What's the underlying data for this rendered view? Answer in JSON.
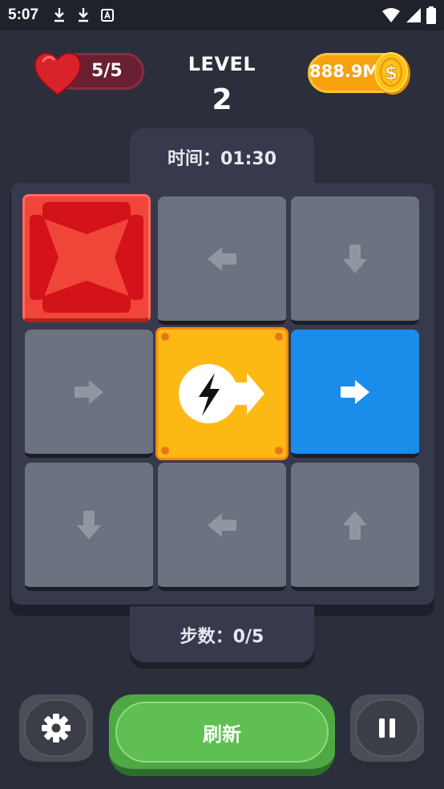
{
  "status_bar": {
    "time": "5:07",
    "left_icons": [
      "download-icon",
      "download-icon",
      "text-a-icon"
    ],
    "right_icons": [
      "wifi-icon",
      "signal-icon",
      "battery-icon"
    ]
  },
  "header": {
    "lives": "5/5",
    "level_label": "LEVEL",
    "level_number": "2",
    "coins": "888.9M",
    "coin_symbol": "$"
  },
  "timer": {
    "text": "时间：01:30"
  },
  "board": {
    "rows": 3,
    "cols": 3,
    "tiles": [
      {
        "type": "blocker",
        "color": "#f0463a",
        "icon": "x-blocker-icon"
      },
      {
        "type": "arrow",
        "direction": "left",
        "color": "#6b7280"
      },
      {
        "type": "arrow",
        "direction": "down",
        "color": "#6b7280"
      },
      {
        "type": "arrow",
        "direction": "right",
        "color": "#6b7280"
      },
      {
        "type": "power",
        "direction": "right",
        "color": "#fdb813",
        "icon": "lightning-icon"
      },
      {
        "type": "arrow",
        "direction": "right",
        "color": "#1a8ce9"
      },
      {
        "type": "arrow",
        "direction": "down",
        "color": "#6b7280"
      },
      {
        "type": "arrow",
        "direction": "left",
        "color": "#6b7280"
      },
      {
        "type": "arrow",
        "direction": "up",
        "color": "#6b7280"
      }
    ]
  },
  "steps": {
    "text": "步数：0/5"
  },
  "controls": {
    "settings_icon": "gear-icon",
    "refresh_label": "刷新",
    "pause_icon": "pause-icon"
  }
}
